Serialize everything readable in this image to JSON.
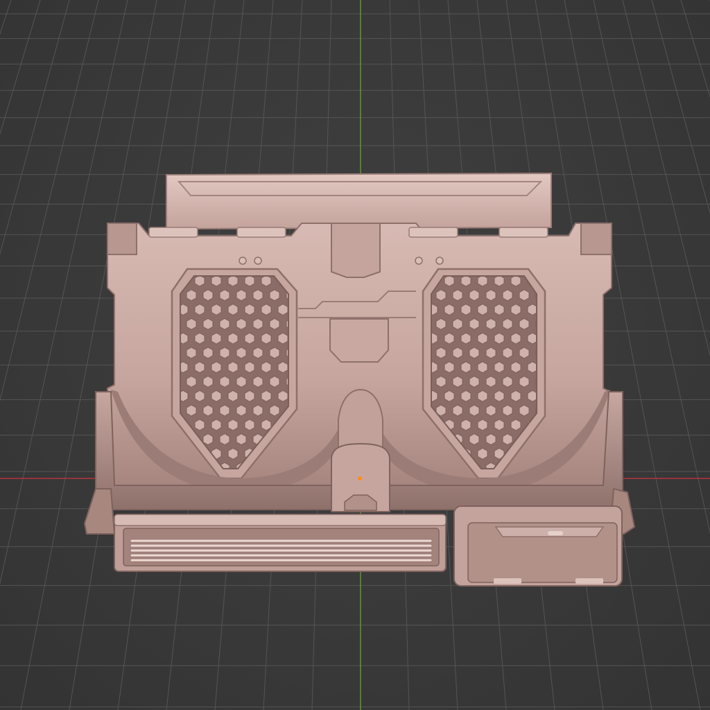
{
  "viewport": {
    "background": "#3b3b3b",
    "grid_color": "#555555",
    "axis_x_color": "#b3343f",
    "axis_y_color": "#5a9a2a"
  },
  "model": {
    "surface_color": "#c9a9a2",
    "shadow_color": "#8a6e6a",
    "highlight_color": "#ecd7d1",
    "origin_marker_color": "#ff8c1a",
    "honeycomb_panels": 2,
    "vent_slats": 5
  }
}
